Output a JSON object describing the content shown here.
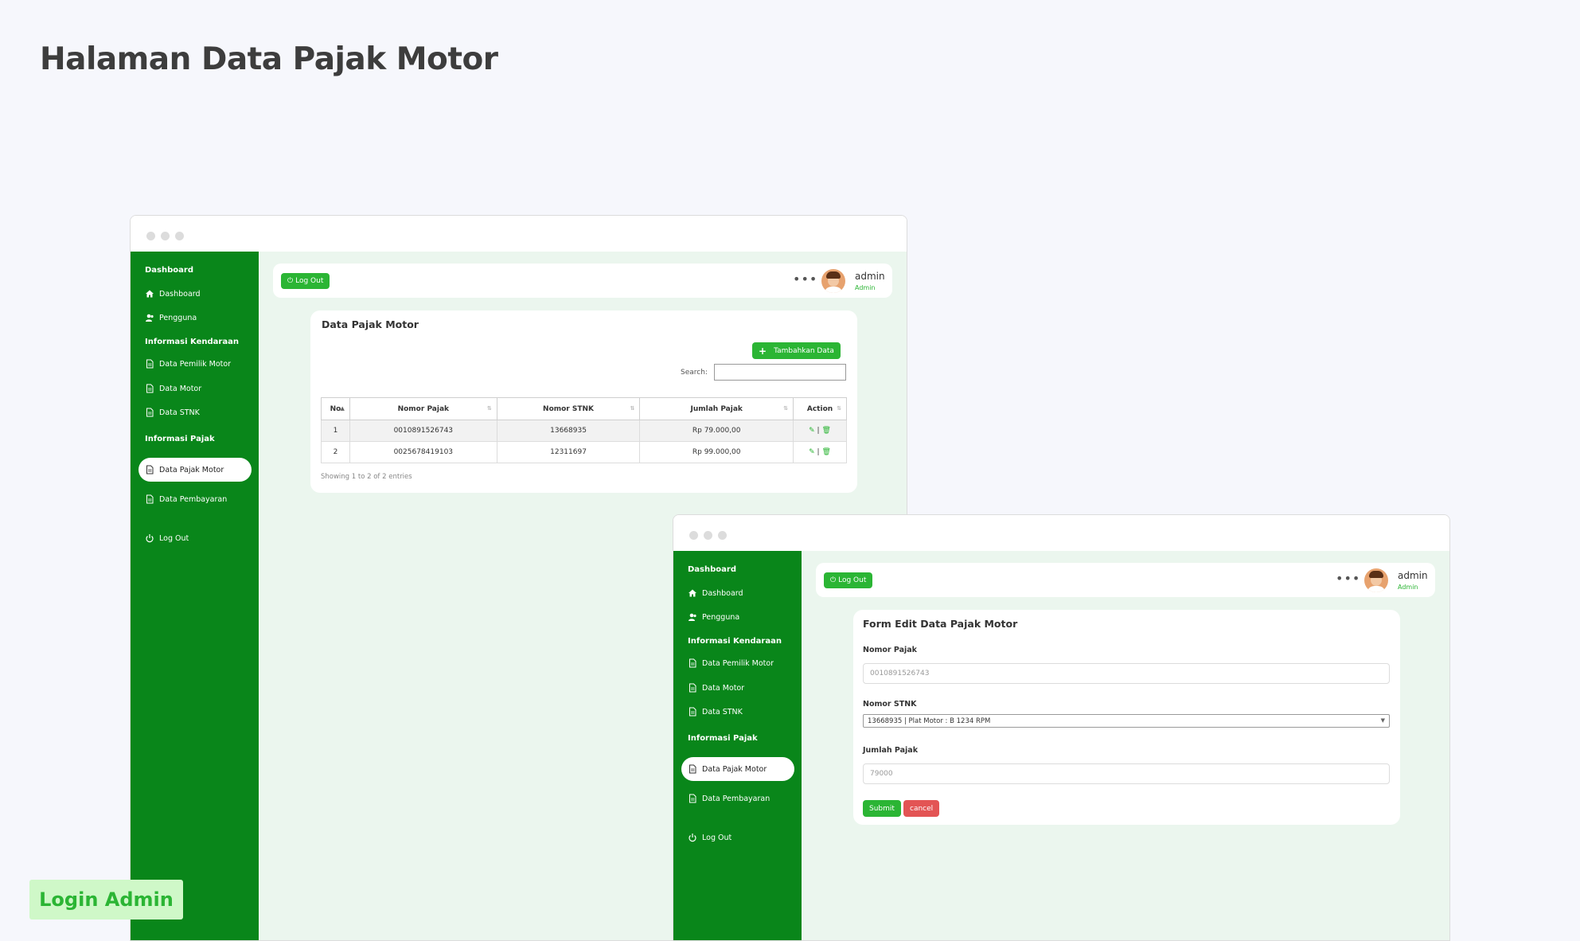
{
  "page": {
    "title": "Halaman Data Pajak Motor",
    "badge": "Login Admin"
  },
  "sidebar": {
    "heading_dashboard": "Dashboard",
    "item_dashboard": "Dashboard",
    "item_pengguna": "Pengguna",
    "heading_kendaraan": "Informasi Kendaraan",
    "item_pemilik": "Data Pemilik Motor",
    "item_motor": "Data Motor",
    "item_stnk": "Data STNK",
    "heading_pajak": "Informasi Pajak",
    "item_pajak": "Data Pajak Motor",
    "item_pembayaran": "Data Pembayaran",
    "item_logout": "Log Out"
  },
  "topbar": {
    "logout_label": "Log Out",
    "more": "•••",
    "user_name": "admin",
    "user_role": "Admin"
  },
  "list_view": {
    "card_title": "Data Pajak Motor",
    "add_button": "Tambahkan Data",
    "search_label": "Search:",
    "columns": [
      "No",
      "Nomor Pajak",
      "Nomor STNK",
      "Jumlah Pajak",
      "Action"
    ],
    "rows": [
      {
        "no": "1",
        "nomor_pajak": "0010891526743",
        "nomor_stnk": "13668935",
        "jumlah_pajak": "Rp 79.000,00"
      },
      {
        "no": "2",
        "nomor_pajak": "0025678419103",
        "nomor_stnk": "12311697",
        "jumlah_pajak": "Rp 99.000,00"
      }
    ],
    "action_separator": "|",
    "footer": "Showing 1 to 2 of 2 entries"
  },
  "edit_view": {
    "card_title": "Form Edit Data Pajak Motor",
    "label_nomor_pajak": "Nomor Pajak",
    "value_nomor_pajak": "0010891526743",
    "label_nomor_stnk": "Nomor STNK",
    "value_nomor_stnk": "13668935 | Plat Motor : B 1234 RPM",
    "label_jumlah_pajak": "Jumlah Pajak",
    "value_jumlah_pajak": "79000",
    "submit_label": "Submit",
    "cancel_label": "cancel"
  },
  "colors": {
    "sidebar_green": "#09861a",
    "accent_green": "#2bb534",
    "danger_red": "#e35454",
    "content_bg": "#ebf6ee",
    "badge_bg": "#cff8c8"
  },
  "icons": [
    "home-icon",
    "users-icon",
    "file-icon",
    "power-icon",
    "edit-icon",
    "trash-icon",
    "plus-icon",
    "sort-icon",
    "caret-down-icon"
  ]
}
